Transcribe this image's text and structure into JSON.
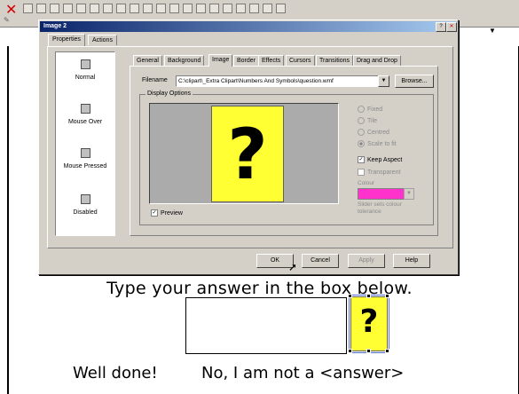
{
  "background": {
    "question_text": "Type your answer in the box below.",
    "small_image_glyph": "?",
    "well_done": "Well done!",
    "no_answer": "No, I am not a <answer>"
  },
  "dialog": {
    "title": "Image 2",
    "outer_tabs": [
      "Properties",
      "Actions"
    ],
    "states": [
      "Normal",
      "Mouse Over",
      "Mouse Pressed",
      "Disabled"
    ],
    "inner_tabs": [
      "General",
      "Background",
      "Image",
      "Border",
      "Effects",
      "Cursors",
      "Transitions",
      "Drag and Drop"
    ],
    "filename_label": "Filename",
    "filename_value": "C:\\clipart\\_Extra Clipart\\Numbers And Symbols\\question.wmf",
    "browse_label": "Browse...",
    "display_options_label": "Display Options",
    "preview_glyph": "?",
    "preview_label": "Preview",
    "radio_fixed": "Fixed",
    "radio_tile": "Tile",
    "radio_centred": "Centred",
    "radio_scale": "Scale to fit",
    "keep_aspect": "Keep Aspect",
    "transparent": "Transparent",
    "colour_label": "Colour",
    "slider_note": "Slider sets colour tolerance",
    "swatch_color": "#ff33cc",
    "ok_label": "OK",
    "cancel_label": "Cancel",
    "apply_label": "Apply",
    "help_label": "Help"
  }
}
